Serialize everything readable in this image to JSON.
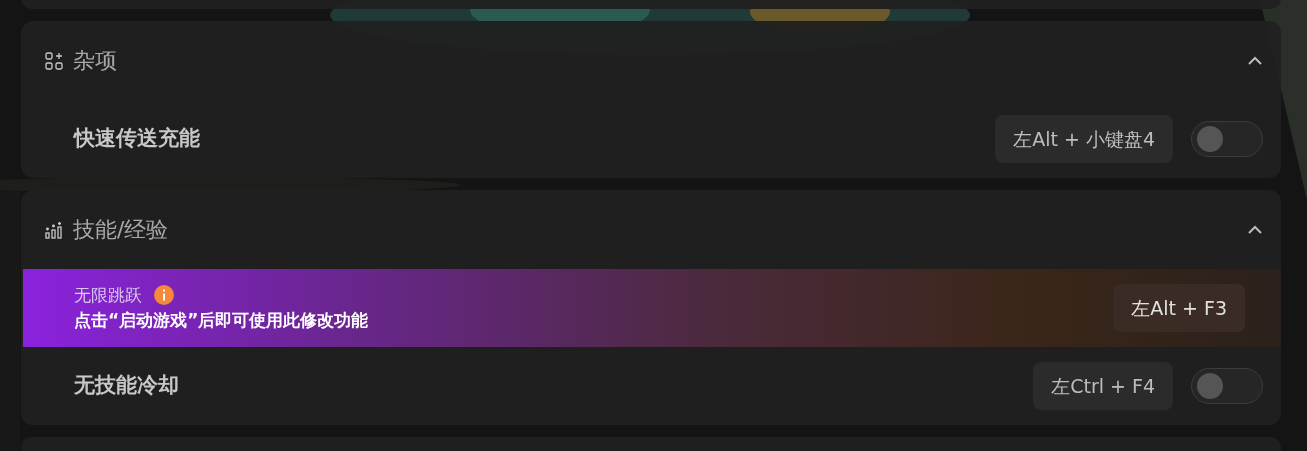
{
  "sections": [
    {
      "title": "杂项",
      "expanded": true,
      "items": [
        {
          "kind": "toggle",
          "label": "快速传送充能",
          "hotkey": "左Alt + 小键盘4",
          "on": false
        }
      ]
    },
    {
      "title": "技能/经验",
      "expanded": true,
      "items": [
        {
          "kind": "notice",
          "label": "无限跳跃",
          "notice": "点击“启动游戏”后即可使用此修改功能",
          "hotkey": "左Alt + F3"
        },
        {
          "kind": "toggle",
          "label": "无技能冷却",
          "hotkey": "左Ctrl + F4",
          "on": false
        }
      ]
    }
  ]
}
